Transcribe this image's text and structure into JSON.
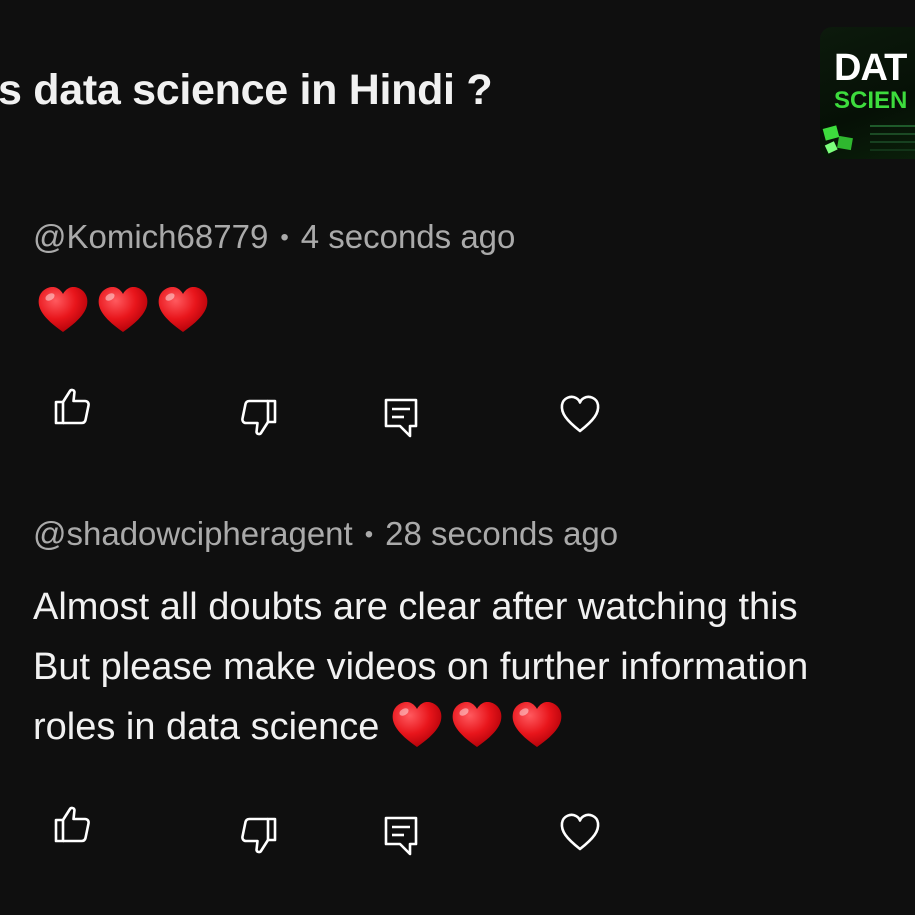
{
  "video": {
    "title": "s data science in Hindi ?",
    "thumbnail": {
      "line1": "DAT",
      "line2": "SCIEN",
      "accent_color": "#3ddc3d"
    }
  },
  "comments": [
    {
      "author": "@Komich68779",
      "separator": "•",
      "time": "4 seconds ago",
      "text_emojis": [
        "heart-emoji",
        "heart-emoji",
        "heart-emoji"
      ],
      "actions": [
        "like-icon",
        "dislike-icon",
        "reply-icon",
        "heart-icon"
      ]
    },
    {
      "author": "@shadowcipheragent",
      "separator": "•",
      "time": "28 seconds ago",
      "text_lines": [
        "Almost all doubts are clear after watching this",
        "But please make videos on further information",
        "roles in data science"
      ],
      "text_emojis": [
        "heart-emoji",
        "heart-emoji",
        "heart-emoji"
      ],
      "actions": [
        "like-icon",
        "dislike-icon",
        "reply-icon",
        "heart-icon"
      ]
    }
  ],
  "colors": {
    "background": "#0f0f0f",
    "meta_text": "#aaaaaa",
    "body_text": "#f1f1f1",
    "heart_red": "#e8151b"
  }
}
